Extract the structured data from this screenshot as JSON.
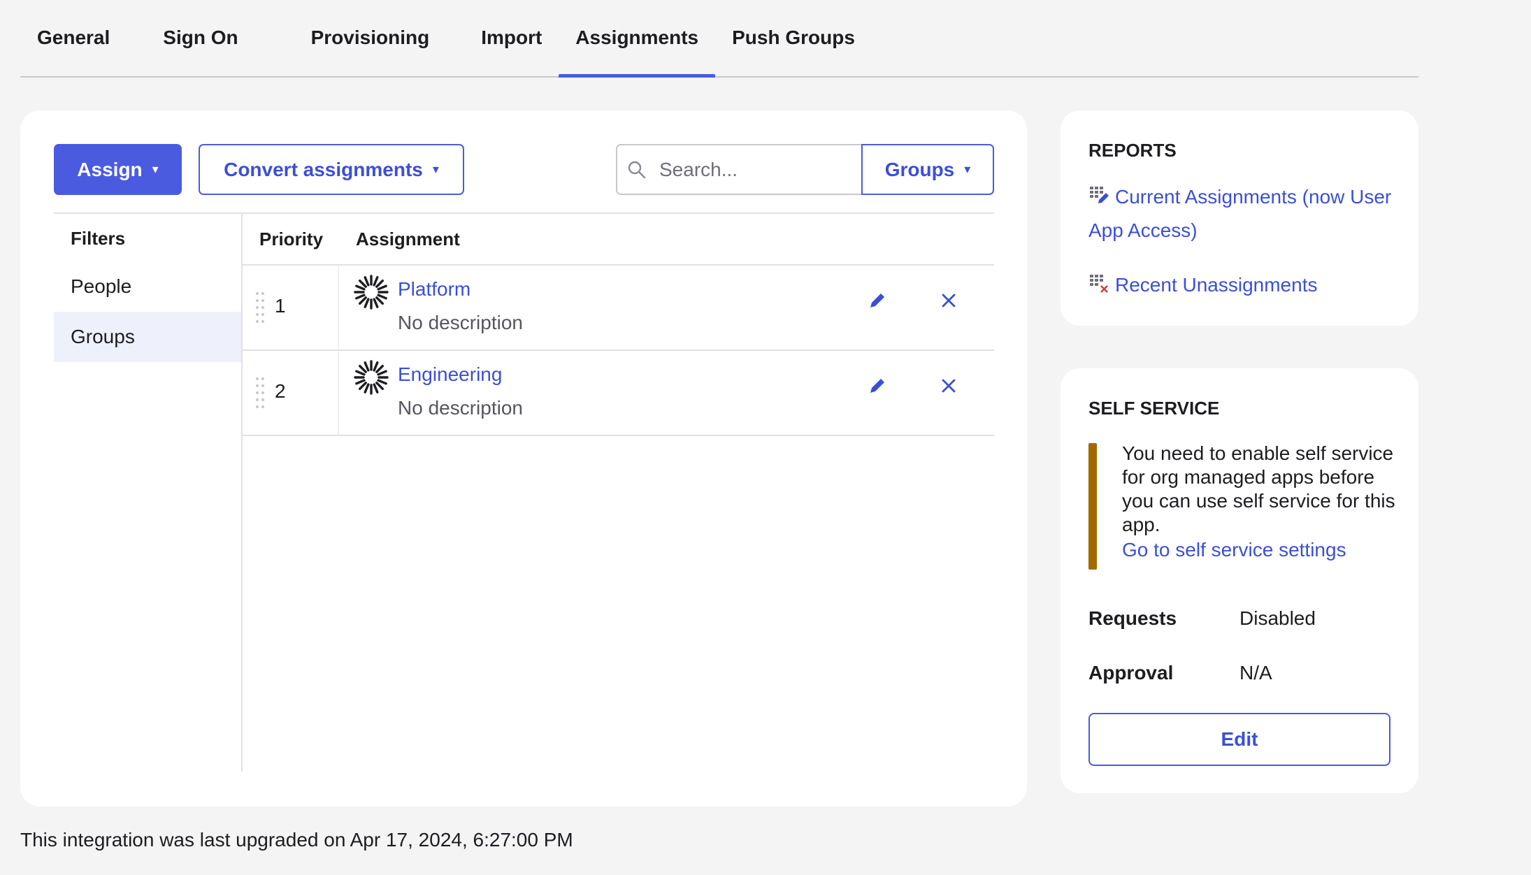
{
  "tabs": [
    {
      "label": "General",
      "active": false
    },
    {
      "label": "Sign On",
      "active": false
    },
    {
      "label": "Provisioning",
      "active": false
    },
    {
      "label": "Import",
      "active": false
    },
    {
      "label": "Assignments",
      "active": true
    },
    {
      "label": "Push Groups",
      "active": false
    }
  ],
  "toolbar": {
    "assign_label": "Assign",
    "convert_label": "Convert assignments",
    "search_placeholder": "Search...",
    "groups_label": "Groups",
    "caret": "▾"
  },
  "filters": {
    "title": "Filters",
    "items": [
      "People",
      "Groups"
    ],
    "selected": "Groups"
  },
  "table": {
    "headers": {
      "priority": "Priority",
      "assignment": "Assignment"
    },
    "rows": [
      {
        "priority": "1",
        "name": "Platform",
        "description": "No description"
      },
      {
        "priority": "2",
        "name": "Engineering",
        "description": "No description"
      }
    ]
  },
  "reports": {
    "title": "REPORTS",
    "links": [
      {
        "label": "Current Assignments (now User App Access)",
        "icon": "report-grid-edit-icon"
      },
      {
        "label": "Recent Unassignments",
        "icon": "report-grid-remove-icon"
      }
    ]
  },
  "self_service": {
    "title": "SELF SERVICE",
    "message": "You need to enable self service for org managed apps before you can use self service for this app.",
    "link": "Go to self service settings",
    "requests_label": "Requests",
    "requests_value": "Disabled",
    "approval_label": "Approval",
    "approval_value": "N/A",
    "edit_label": "Edit",
    "warning_color": "#a06a00"
  },
  "footer": {
    "note": "This integration was last upgraded on Apr 17, 2024, 6:27:00 PM"
  },
  "colors": {
    "accent": "#4a5be0",
    "link": "#3b4fd6",
    "background": "#f4f4f4"
  }
}
